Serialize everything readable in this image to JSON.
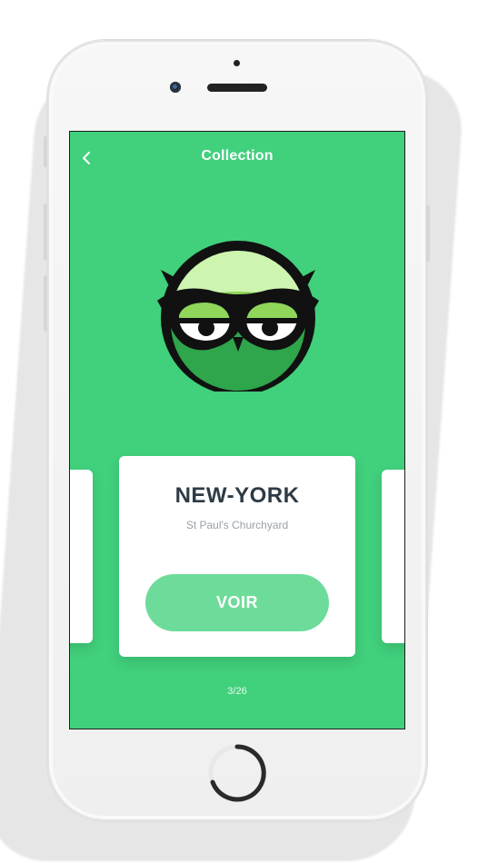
{
  "header": {
    "title": "Collection",
    "back_icon": "chevron-left-icon"
  },
  "hero": {
    "icon": "owl-logo"
  },
  "card": {
    "city": "NEW-YORK",
    "place": "St Paul's Churchyard",
    "button_label": "VOIR"
  },
  "pager": {
    "text": "3/26"
  },
  "colors": {
    "screen_bg": "#41d07c",
    "button_bg": "#6ddc9a",
    "card_bg": "#ffffff",
    "title_text": "#2e3b45",
    "subtitle_text": "#9aa1a7"
  }
}
